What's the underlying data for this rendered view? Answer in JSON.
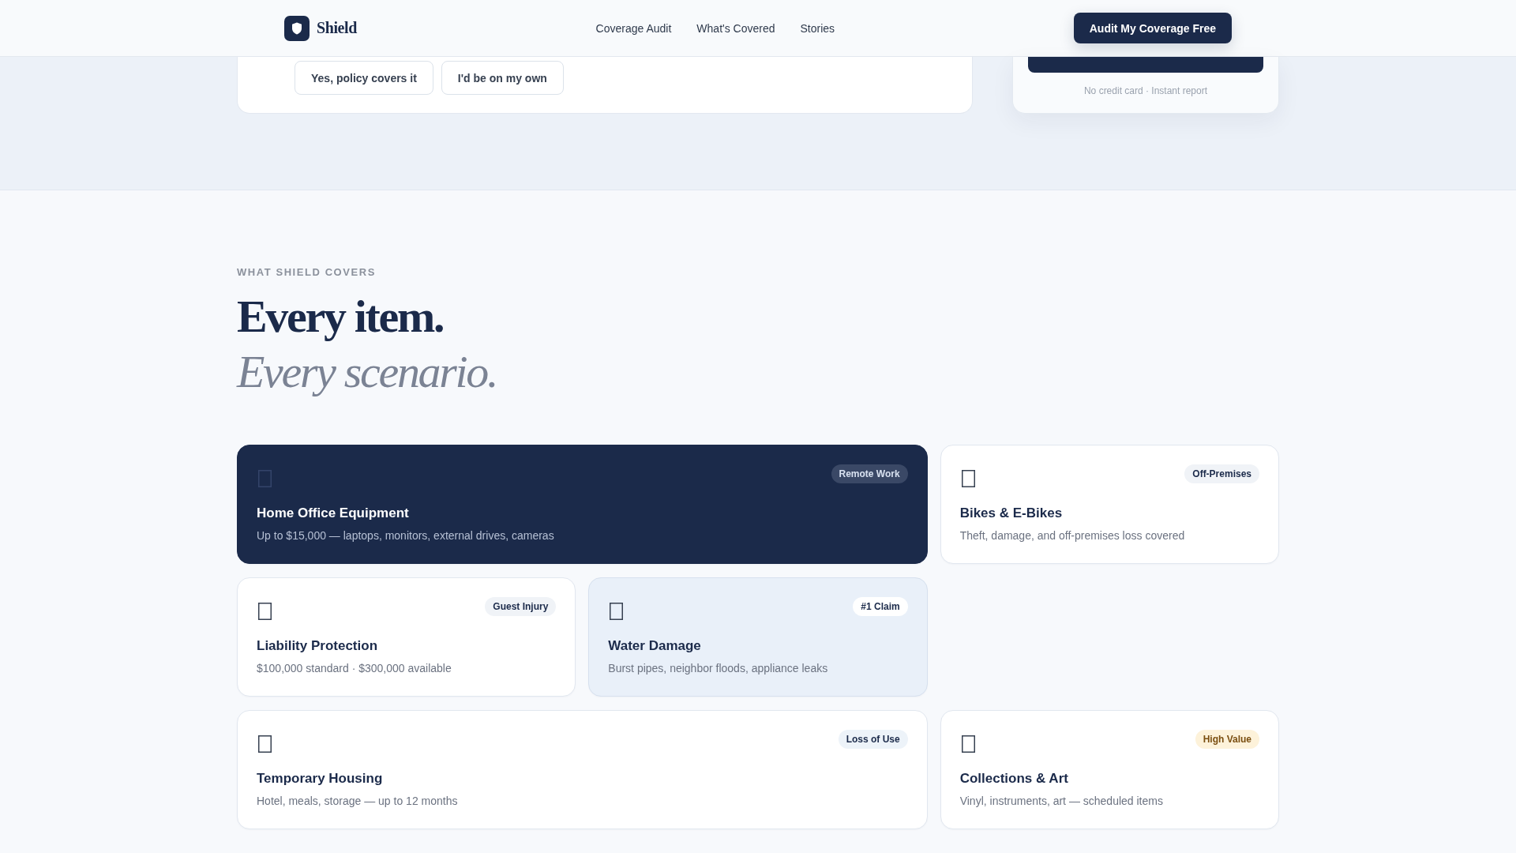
{
  "header": {
    "logo": {
      "name": "Shield"
    },
    "nav_links": [
      "Coverage Audit",
      "What's Covered",
      "Stories"
    ],
    "cta": "Audit My Coverage Free"
  },
  "hero": {
    "answer_options": [
      {
        "label": "Yes, policy covers it",
        "selected": false
      },
      {
        "label": "I'd be on my own",
        "selected": false
      }
    ],
    "audit_card": {
      "note": "No credit card · Instant report"
    }
  },
  "coverage": {
    "eyebrow": "WHAT SHIELD COVERS",
    "heading": "Every item.",
    "heading_accent": "Every scenario.",
    "cards": [
      {
        "kind": "dark",
        "title": "Home Office Equipment",
        "description": "Up to $15,000 — laptops, monitors, external drives, cameras",
        "tag": {
          "label": "Remote Work",
          "kind": "inverse"
        }
      },
      {
        "kind": "plain",
        "title": "Bikes & E-Bikes",
        "description": "Theft, damage, and off-premises loss covered",
        "tag": {
          "label": "Off-Premises",
          "kind": "neutral"
        }
      },
      {
        "kind": "plain",
        "title": "Liability Protection",
        "description": "$100,000 standard · $300,000 available",
        "tag": {
          "label": "Guest Injury",
          "kind": "neutral"
        }
      },
      {
        "kind": "tinted",
        "title": "Water Damage",
        "description": "Burst pipes, neighbor floods, appliance leaks",
        "tag": {
          "label": "#1 Claim",
          "kind": "white"
        }
      },
      {
        "kind": "plain",
        "title": "Temporary Housing",
        "description": "Hotel, meals, storage — up to 12 months",
        "tag": {
          "label": "Loss of Use",
          "kind": "cool"
        }
      },
      {
        "kind": "plain",
        "title": "Collections & Art",
        "description": "Vinyl, instruments, art — scheduled items",
        "tag": {
          "label": "High Value",
          "kind": "warm"
        }
      }
    ]
  }
}
